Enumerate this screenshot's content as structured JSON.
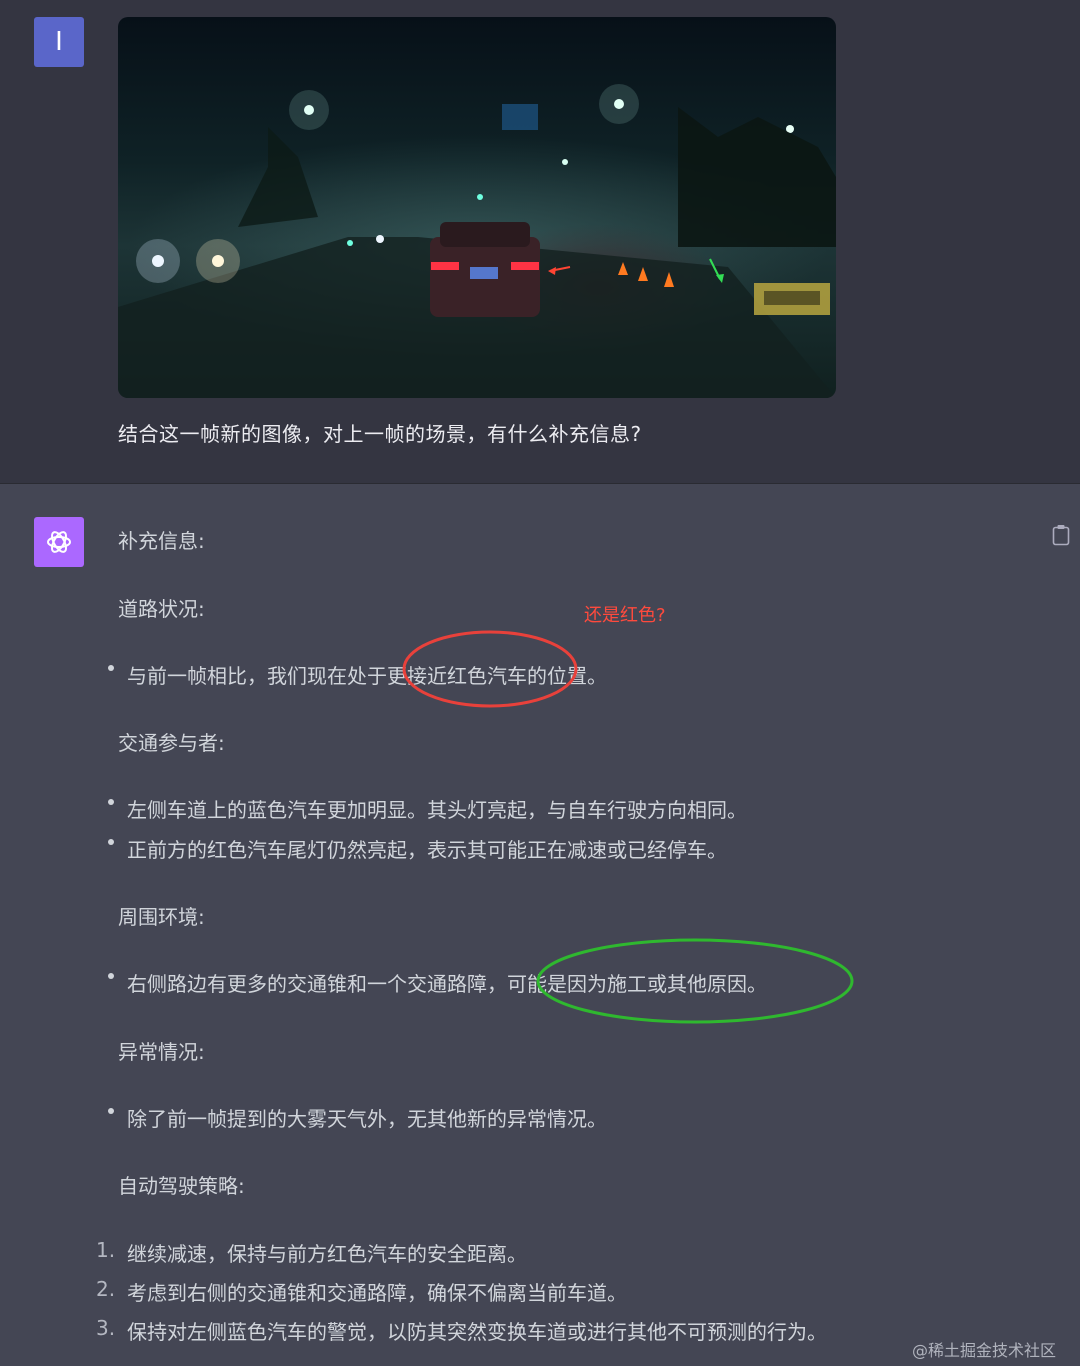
{
  "user": {
    "avatar_letter": "I",
    "question": "结合这一帧新的图像，对上一帧的场景，有什么补充信息?"
  },
  "assistant": {
    "intro": "补充信息:",
    "sections": [
      {
        "title": "道路状况:",
        "bullets": [
          "与前一帧相比，我们现在处于更接近红色汽车的位置。"
        ]
      },
      {
        "title": "交通参与者:",
        "bullets": [
          "左侧车道上的蓝色汽车更加明显。其头灯亮起，与自车行驶方向相同。",
          "正前方的红色汽车尾灯仍然亮起，表示其可能正在减速或已经停车。"
        ]
      },
      {
        "title": "周围环境:",
        "bullets": [
          "右侧路边有更多的交通锥和一个交通路障，可能是因为施工或其他原因。"
        ]
      },
      {
        "title": "异常情况:",
        "bullets": [
          "除了前一帧提到的大雾天气外，无其他新的异常情况。"
        ]
      },
      {
        "title": "自动驾驶策略:",
        "numbered": [
          {
            "num": "1.",
            "text": "继续减速，保持与前方红色汽车的安全距离。"
          },
          {
            "num": "2.",
            "text": "考虑到右侧的交通锥和交通路障，确保不偏离当前车道。"
          },
          {
            "num": "3.",
            "text": "保持对左侧蓝色汽车的警觉，以防其突然变换车道或进行其他不可预测的行为。"
          }
        ]
      }
    ]
  },
  "annotations": {
    "red_note": "还是红色?",
    "red_color": "#e8413b",
    "green_color": "#2fb82f"
  },
  "icons": {
    "copy": "clipboard-icon",
    "bot": "openai-logo-icon"
  },
  "watermark": "@稀土掘金技术社区"
}
